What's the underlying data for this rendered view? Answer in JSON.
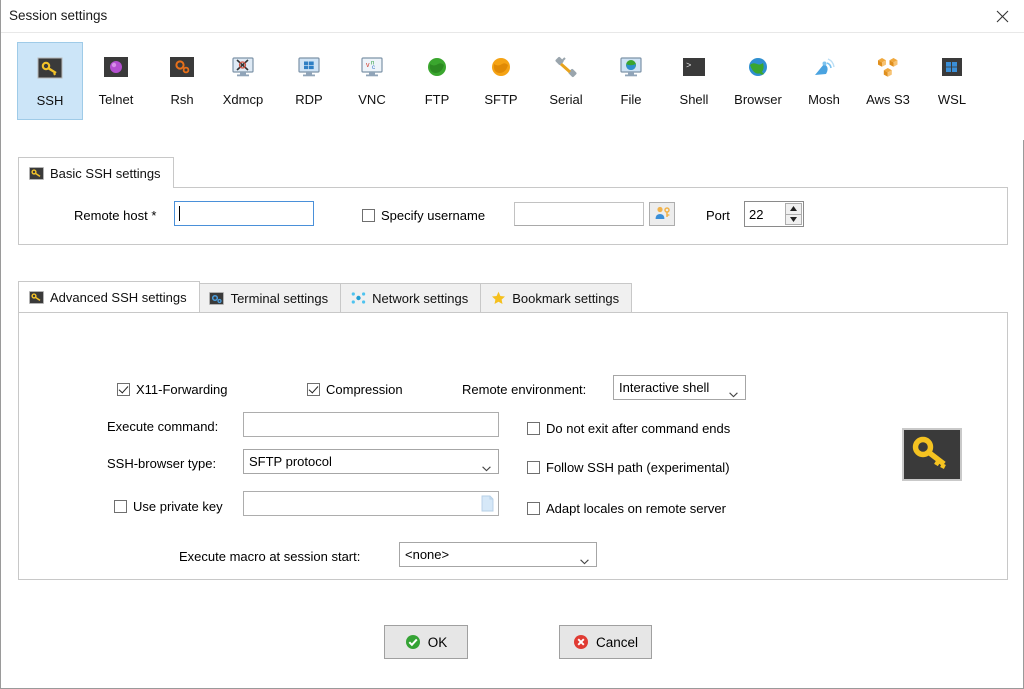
{
  "window": {
    "title": "Session settings",
    "close_label": "×"
  },
  "protocols": [
    {
      "id": "ssh",
      "label": "SSH",
      "icon": "key-dark-icon",
      "selected": true
    },
    {
      "id": "telnet",
      "label": "Telnet",
      "icon": "purple-blob-icon",
      "selected": false
    },
    {
      "id": "rsh",
      "label": "Rsh",
      "icon": "orange-gear-icon",
      "selected": false
    },
    {
      "id": "xdmcp",
      "label": "Xdmcp",
      "icon": "monitor-x-icon",
      "selected": false
    },
    {
      "id": "rdp",
      "label": "RDP",
      "icon": "monitor-windows-icon",
      "selected": false
    },
    {
      "id": "vnc",
      "label": "VNC",
      "icon": "monitor-vnc-icon",
      "selected": false
    },
    {
      "id": "ftp",
      "label": "FTP",
      "icon": "globe-green-icon",
      "selected": false
    },
    {
      "id": "sftp",
      "label": "SFTP",
      "icon": "globe-orange-icon",
      "selected": false
    },
    {
      "id": "serial",
      "label": "Serial",
      "icon": "plug-icon",
      "selected": false
    },
    {
      "id": "file",
      "label": "File",
      "icon": "monitor-globe-icon",
      "selected": false
    },
    {
      "id": "shell",
      "label": "Shell",
      "icon": "terminal-icon",
      "selected": false
    },
    {
      "id": "browser",
      "label": "Browser",
      "icon": "globe-blue-icon",
      "selected": false
    },
    {
      "id": "mosh",
      "label": "Mosh",
      "icon": "satellite-dish-icon",
      "selected": false
    },
    {
      "id": "awss3",
      "label": "Aws S3",
      "icon": "aws-cubes-icon",
      "selected": false
    },
    {
      "id": "wsl",
      "label": "WSL",
      "icon": "windows-square-icon",
      "selected": false
    }
  ],
  "basic_panel": {
    "tab_label": "Basic SSH settings",
    "tab_icon": "key-dark-icon",
    "remote_host": {
      "label": "Remote host *",
      "value": "",
      "focused": true
    },
    "specify_username": {
      "label": "Specify username",
      "checked": false,
      "value": ""
    },
    "username_picker_icon": "user-key-icon",
    "port": {
      "label": "Port",
      "value": "22"
    }
  },
  "advanced_tabs": [
    {
      "id": "advanced",
      "label": "Advanced SSH settings",
      "icon": "key-dark-icon",
      "active": true
    },
    {
      "id": "terminal",
      "label": "Terminal settings",
      "icon": "terminal-gear-icon",
      "active": false
    },
    {
      "id": "network",
      "label": "Network settings",
      "icon": "network-nodes-icon",
      "active": false
    },
    {
      "id": "bookmark",
      "label": "Bookmark settings",
      "icon": "star-icon",
      "active": false
    }
  ],
  "advanced_panel": {
    "x11_forwarding": {
      "label": "X11-Forwarding",
      "checked": true
    },
    "compression": {
      "label": "Compression",
      "checked": true
    },
    "remote_environment": {
      "label": "Remote environment:",
      "value": "Interactive shell"
    },
    "execute_command": {
      "label": "Execute command:",
      "value": ""
    },
    "ssh_browser_type": {
      "label": "SSH-browser type:",
      "value": "SFTP protocol"
    },
    "use_private_key": {
      "label": "Use private key",
      "checked": false,
      "value": "",
      "browse_icon": "file-page-icon"
    },
    "do_not_exit": {
      "label": "Do not exit after command ends",
      "checked": false
    },
    "follow_ssh_path": {
      "label": "Follow SSH path (experimental)",
      "checked": false
    },
    "adapt_locales": {
      "label": "Adapt locales on remote server",
      "checked": false
    },
    "execute_macro": {
      "label": "Execute macro at session start:",
      "value": "<none>"
    },
    "key_art_icon": "gold-key-icon"
  },
  "footer": {
    "ok": {
      "label": "OK",
      "icon": "green-check-icon"
    },
    "cancel": {
      "label": "Cancel",
      "icon": "red-x-icon"
    }
  },
  "colors": {
    "selection": "#cce5f8",
    "selection_border": "#9fcbe8",
    "focus_border": "#4a90d9",
    "panel_border": "#c8c8c8",
    "ok_green": "#35a335",
    "cancel_red": "#e03b33",
    "key_gold": "#f5c321"
  }
}
